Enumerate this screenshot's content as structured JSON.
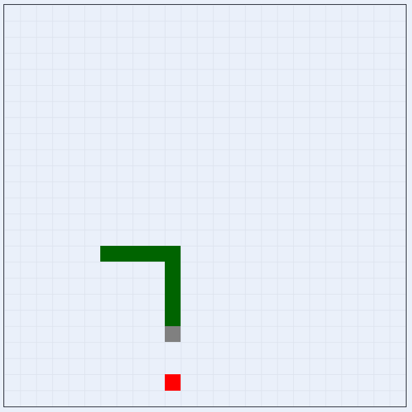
{
  "game": {
    "board": {
      "cols": 25,
      "rows": 25,
      "background": "#eaf0fa",
      "grid_color": "#dde3ee",
      "border_color": "#1b1f2a"
    },
    "snake": {
      "body_color": "#006400",
      "tail_color": "#808080",
      "segments": [
        {
          "col": 6,
          "row": 15
        },
        {
          "col": 7,
          "row": 15
        },
        {
          "col": 8,
          "row": 15
        },
        {
          "col": 9,
          "row": 15
        },
        {
          "col": 10,
          "row": 15
        },
        {
          "col": 10,
          "row": 16
        },
        {
          "col": 10,
          "row": 17
        },
        {
          "col": 10,
          "row": 18
        },
        {
          "col": 10,
          "row": 19
        }
      ],
      "tail": {
        "col": 10,
        "row": 20
      }
    },
    "food": {
      "col": 10,
      "row": 23,
      "color": "#ff0000"
    }
  }
}
